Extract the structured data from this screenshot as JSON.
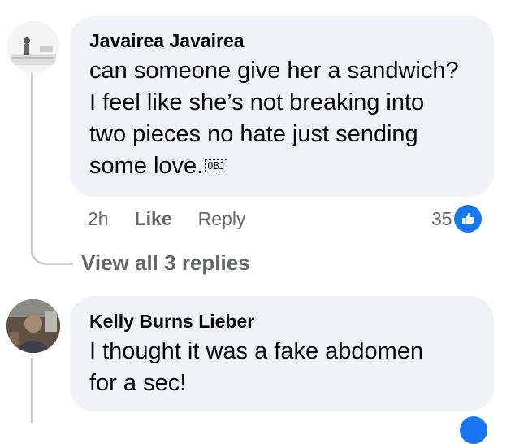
{
  "comments": [
    {
      "author": "Javairea Javairea",
      "text_lines": [
        "can someone give her a sandwich?",
        "I feel like she’s not breaking into",
        "two pieces no hate just sending",
        "some love."
      ],
      "emoji_placeholder": "OBJ",
      "time": "2h",
      "like_label": "Like",
      "reply_label": "Reply",
      "reaction_count": "35",
      "view_replies_label": "View all 3 replies"
    },
    {
      "author": "Kelly Burns Lieber",
      "text_lines": [
        "I thought it was a fake abdomen",
        "for a sec!"
      ]
    }
  ],
  "icons": {
    "reaction": "like-thumbs-up-icon"
  },
  "colors": {
    "bubble": "#f0f2f5",
    "secondary_text": "#65676b",
    "like_blue": "#1877f2",
    "thread_line": "#ced0d4"
  }
}
